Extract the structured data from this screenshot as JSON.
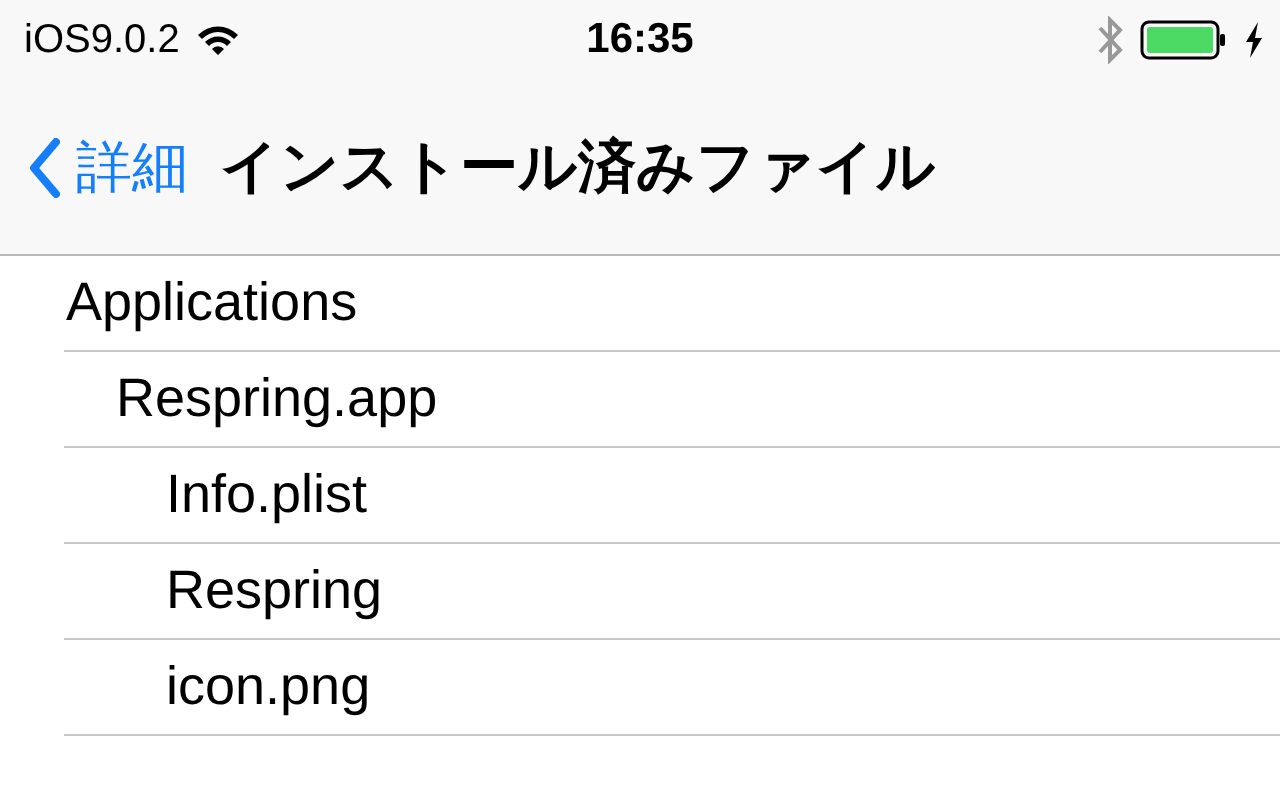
{
  "status_bar": {
    "carrier": "iOS9.0.2",
    "time": "16:35",
    "charging": true
  },
  "nav_bar": {
    "back_label": "詳細",
    "title": "インストール済みファイル"
  },
  "tree": [
    {
      "name": "Applications",
      "children": [
        {
          "name": "Respring.app",
          "children": [
            {
              "name": "Info.plist"
            },
            {
              "name": "Respring"
            },
            {
              "name": "icon.png"
            }
          ]
        }
      ]
    }
  ]
}
